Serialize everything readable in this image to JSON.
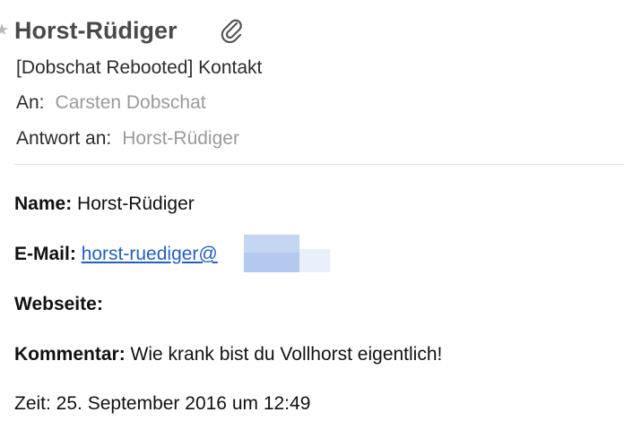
{
  "header": {
    "sender": "Horst-Rüdiger",
    "subject": "[Dobschat Rebooted] Kontakt",
    "to_label": "An:",
    "to_value": "Carsten Dobschat",
    "reply_label": "Antwort an:",
    "reply_value": "Horst-Rüdiger",
    "icons": [
      "star-icon",
      "paperclip-icon"
    ]
  },
  "body": {
    "name_label": "Name:",
    "name_value": "Horst-Rüdiger",
    "email_label": "E-Mail:",
    "email_value": "horst-ruediger@",
    "website_label": "Webseite:",
    "comment_label": "Kommentar:",
    "comment_value": "Wie krank bist du Vollhorst eigentlich!",
    "time_text": "Zeit: 25. September 2016 um 12:49"
  },
  "colors": {
    "sender": "#4a4a4a",
    "meta_value": "#9a9a9a",
    "link": "#1f5fc7",
    "divider": "#e2e2e2",
    "redaction": "#c4d6f2"
  }
}
